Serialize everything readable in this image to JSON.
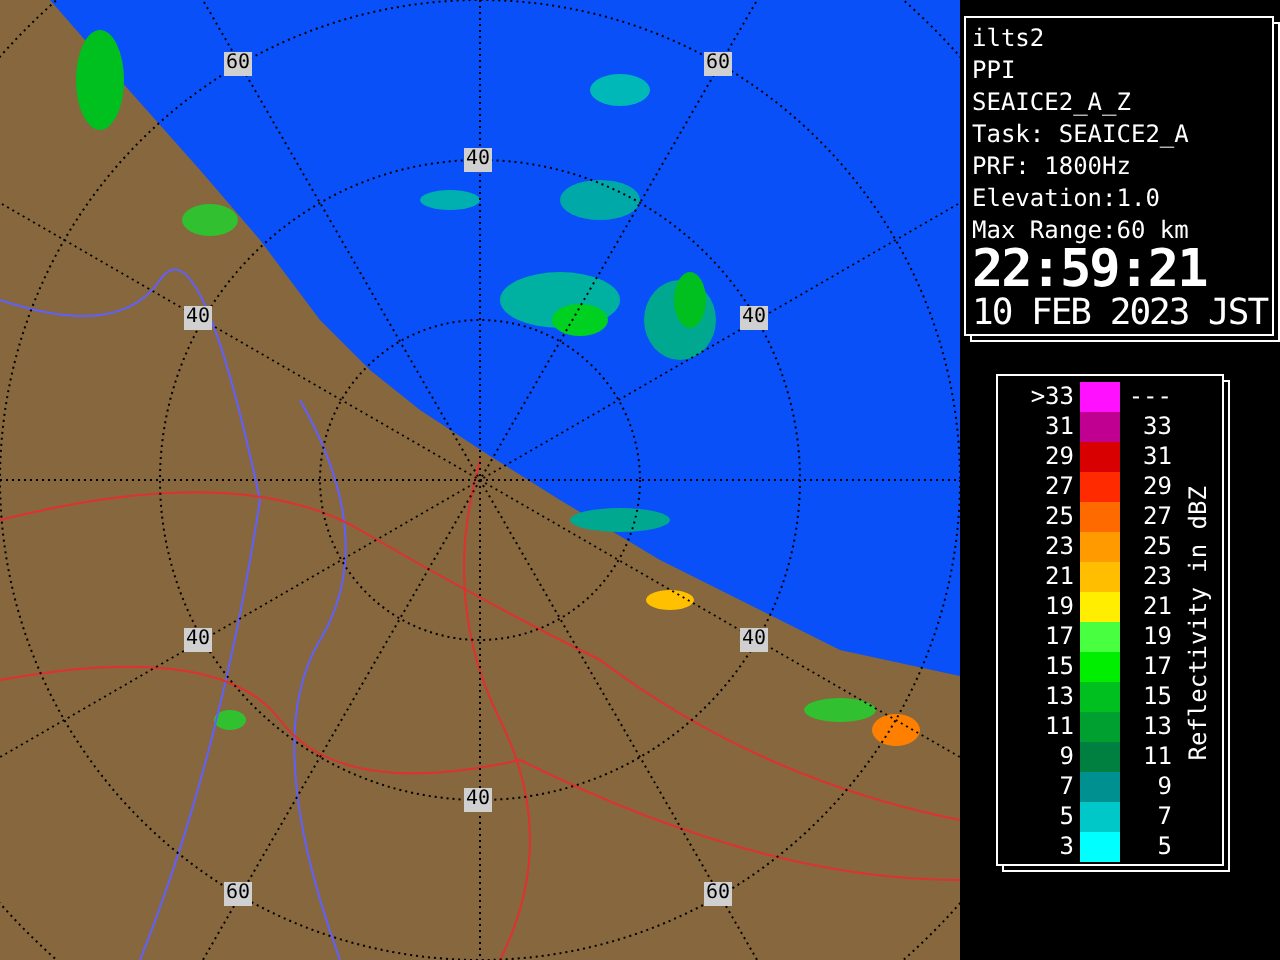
{
  "map": {
    "range_labels": [
      {
        "text": "60"
      },
      {
        "text": "60"
      },
      {
        "text": "40"
      },
      {
        "text": "40"
      },
      {
        "text": "40"
      },
      {
        "text": "40"
      },
      {
        "text": "40"
      },
      {
        "text": "40"
      },
      {
        "text": "60"
      },
      {
        "text": "60"
      }
    ]
  },
  "info": {
    "lines": [
      "ilts2",
      "PPI",
      "SEAICE2_A_Z",
      "Task: SEAICE2_A",
      "PRF: 1800Hz",
      "Elevation:1.0",
      "Max Range:60 km"
    ],
    "time": "22:59:21",
    "date": "10 FEB 2023 JST"
  },
  "legend": {
    "title": "Reflectivity in dBZ",
    "rows": [
      {
        "low": ">33",
        "high": "---",
        "color": "#ff10ff"
      },
      {
        "low": "31",
        "high": "33",
        "color": "#c00090"
      },
      {
        "low": "29",
        "high": "31",
        "color": "#d80000"
      },
      {
        "low": "27",
        "high": "29",
        "color": "#ff2a00"
      },
      {
        "low": "25",
        "high": "27",
        "color": "#ff6a00"
      },
      {
        "low": "23",
        "high": "25",
        "color": "#ff9a00"
      },
      {
        "low": "21",
        "high": "23",
        "color": "#ffbe00"
      },
      {
        "low": "19",
        "high": "21",
        "color": "#ffee00"
      },
      {
        "low": "17",
        "high": "19",
        "color": "#48ff40"
      },
      {
        "low": "15",
        "high": "17",
        "color": "#00ee00"
      },
      {
        "low": "13",
        "high": "15",
        "color": "#00c020"
      },
      {
        "low": "11",
        "high": "13",
        "color": "#00a030"
      },
      {
        "low": "9",
        "high": "11",
        "color": "#008040"
      },
      {
        "low": "7",
        "high": "9",
        "color": "#009090"
      },
      {
        "low": "5",
        "high": "7",
        "color": "#00c8c8"
      },
      {
        "low": "3",
        "high": "5",
        "color": "#00ffff"
      }
    ]
  }
}
